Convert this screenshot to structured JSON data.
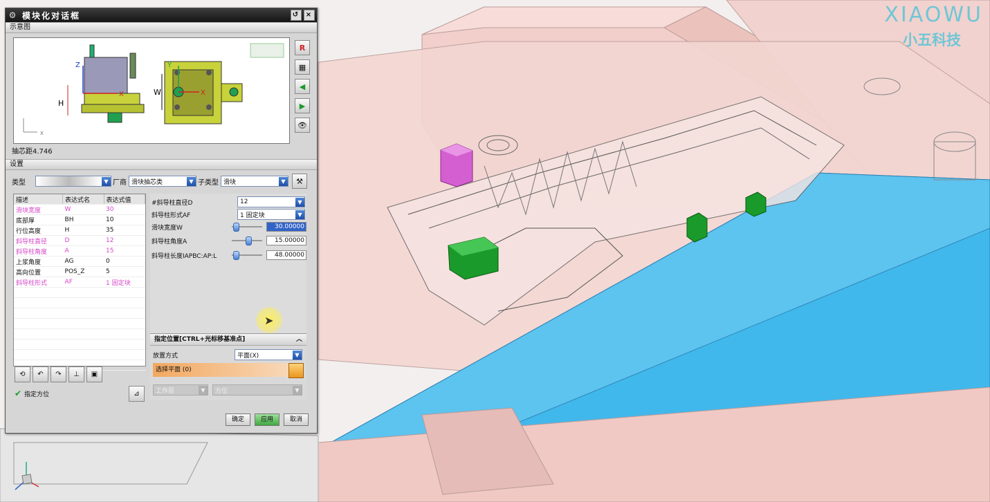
{
  "brand": {
    "name_en": "XIAOWU",
    "name_cn": "小五科技"
  },
  "dialog": {
    "title": "模块化对话框",
    "preview_section": "示意图",
    "preview_axes": {
      "z": "Z",
      "x": "X",
      "y": "Y",
      "w": "W",
      "h": "H"
    },
    "status_text": "抽芯距4.746",
    "settings_section": "设置",
    "type_label": "类型",
    "vendor_label": "厂商",
    "vendor_value": "滑块抽芯类",
    "subtype_label": "子类型",
    "subtype_value": "滑块",
    "table": {
      "headers": [
        "描述",
        "表达式名",
        "表达式值"
      ],
      "rows": [
        {
          "desc": "滑块宽度",
          "name": "W",
          "value": "30",
          "highlight": true
        },
        {
          "desc": "底部厚",
          "name": "BH",
          "value": "10",
          "highlight": false
        },
        {
          "desc": "行位高度",
          "name": "H",
          "value": "35",
          "highlight": false
        },
        {
          "desc": "斜导柱直径",
          "name": "D",
          "value": "12",
          "highlight": true
        },
        {
          "desc": "斜导柱角度",
          "name": "A",
          "value": "15",
          "highlight": true
        },
        {
          "desc": "上浆角度",
          "name": "AG",
          "value": "0",
          "highlight": false
        },
        {
          "desc": "高向位置",
          "name": "POS_Z",
          "value": "5",
          "highlight": false
        },
        {
          "desc": "斜导柱形式",
          "name": "AF",
          "value": "1 固定块",
          "highlight": true
        }
      ]
    },
    "params": {
      "d_label": "#斜导柱直径D",
      "d_value": "12",
      "af_label": "斜导柱形式AF",
      "af_value": "1 固定块",
      "w_label": "滑块宽度W",
      "w_value": "30.00000",
      "w_level": 0.05,
      "a_label": "斜导柱角度A",
      "a_value": "15.00000",
      "a_level": 0.55,
      "l_label": "斜导柱长度IAPBC:AP:L",
      "l_value": "48.00000",
      "l_level": 0.05
    },
    "placement": {
      "header": "指定位置[CTRL+光标移基准点]",
      "method_label": "放置方式",
      "method_value": "平面(X)",
      "select_plane": "选择平面 (0)",
      "disabled_label_1": "工作层",
      "disabled_label_2": "方位"
    },
    "specify_orientation": "指定方位",
    "buttons": {
      "ok": "确定",
      "apply": "应用",
      "cancel": "取消"
    }
  },
  "colors": {
    "dialog_bg": "#d6d6d6",
    "pink_text": "#d646c8",
    "highlight_blue": "#3264c8",
    "apply_green": "#3fa83f",
    "mold_pink": "#f0c9c4",
    "mold_blue": "#3fb6ea",
    "slider_green": "#1a9a2a",
    "brand_cyan": "#6fc6d6"
  },
  "icons": [
    "gear-icon",
    "restore-icon",
    "close-icon",
    "reset-icon",
    "calculator-icon",
    "arrow-left-icon",
    "arrow-right-icon",
    "eye-icon",
    "checkmark-icon"
  ]
}
